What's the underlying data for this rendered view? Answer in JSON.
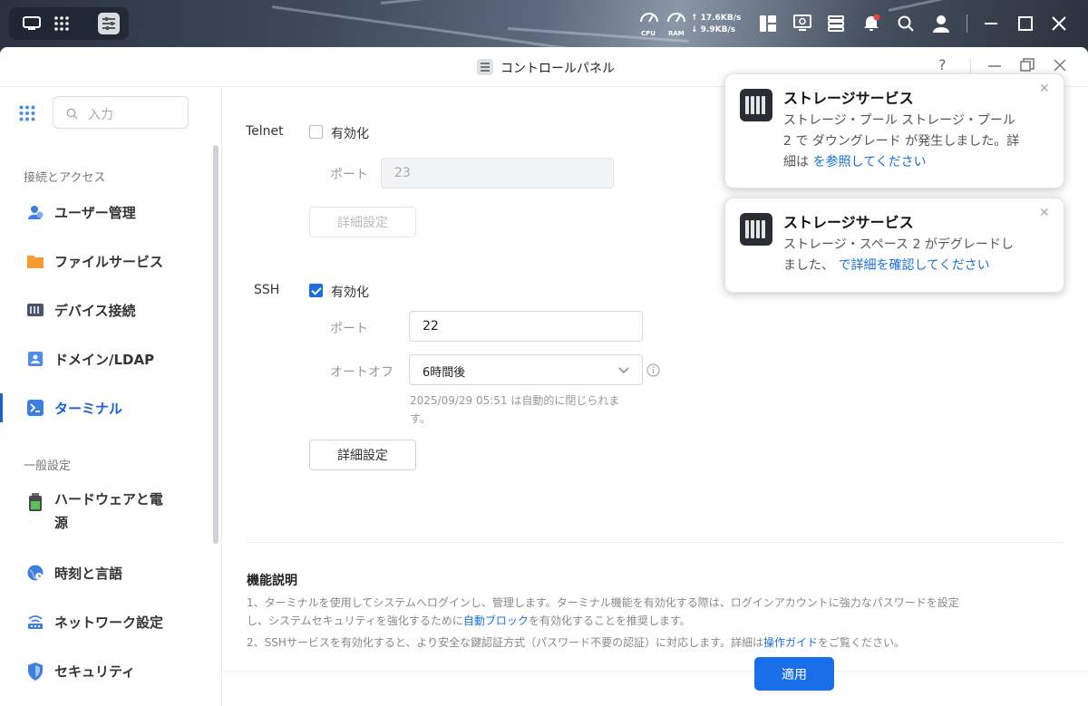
{
  "taskbar": {
    "cpu_label": "CPU",
    "ram_label": "RAM",
    "upload_rate": "↑ 17.6KB/s",
    "download_rate": "↓ 9.9KB/s"
  },
  "window": {
    "title": "コントロールパネル",
    "help": "?"
  },
  "sidebar": {
    "search_placeholder": "入力",
    "section_access": "接続とアクセス",
    "section_general": "一般設定",
    "items": [
      {
        "label": "ユーザー管理"
      },
      {
        "label": "ファイルサービス"
      },
      {
        "label": "デバイス接続"
      },
      {
        "label": "ドメイン/LDAP"
      },
      {
        "label": "ターミナル"
      },
      {
        "label": "ハードウェアと電"
      },
      {
        "label": "時刻と言語"
      },
      {
        "label": "ネットワーク設定"
      },
      {
        "label": "セキュリティ"
      }
    ],
    "item5_line2": "源"
  },
  "telnet": {
    "label": "Telnet",
    "enable_label": "有効化",
    "enabled": false,
    "port_label": "ポート",
    "port_value": "23",
    "advanced_label": "詳細設定"
  },
  "ssh": {
    "label": "SSH",
    "enable_label": "有効化",
    "enabled": true,
    "port_label": "ポート",
    "port_value": "22",
    "autooff_label": "オートオフ",
    "autooff_value": "6時間後",
    "autooff_note_line1": "2025/09/29 05:51 は自動的に閉じられま",
    "autooff_note_line2": "す。",
    "advanced_label": "詳細設定"
  },
  "description": {
    "title": "機能説明",
    "line1": "1、ターミナルを使用してシステムへログインし、管理します。ターミナル機能を有効化する際は、ログインアカウントに強力なパスワードを設定",
    "line2_pre": "し、システムセキュリティを強化するために",
    "line2_link": "自動ブロック",
    "line2_post": "を有効化することを推奨します。",
    "line3_pre": "2、SSHサービスを有効化すると、より安全な鍵認証方式（パスワード不要の認証）に対応します。詳細は",
    "line3_link": "操作ガイド",
    "line3_post": "をご覧ください。"
  },
  "apply_label": "適用",
  "notifications": [
    {
      "title": "ストレージサービス",
      "line1": "ストレージ・プール ストレージ・プール",
      "line2": "2 で ダウングレード が発生しました。詳",
      "line3_pre": "細は ",
      "line3_link": "を参照してください"
    },
    {
      "title": "ストレージサービス",
      "line1": "ストレージ・スペース 2 がデグレードし",
      "line2_pre": "ました、 ",
      "line2_link": "で詳細を確認してください"
    }
  ],
  "colors": {
    "accent": "#1a6fe8",
    "link": "#1a6fe0"
  }
}
